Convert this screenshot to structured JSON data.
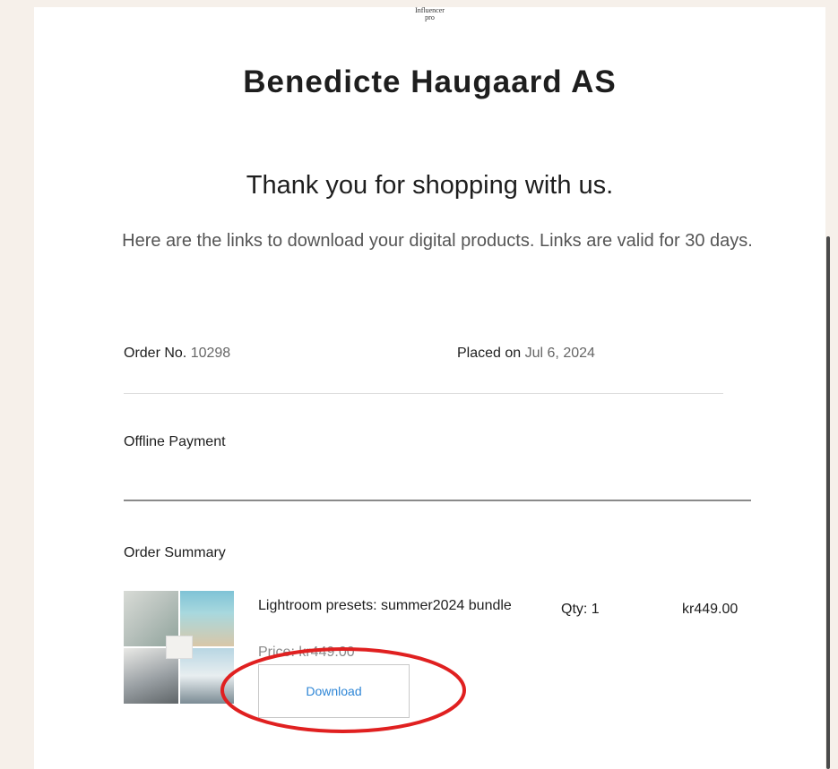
{
  "logo": {
    "line1": "Influencer",
    "line2": "pro"
  },
  "brand": "Benedicte Haugaard AS",
  "thanks": "Thank you for shopping with us.",
  "intro": "Here are the links to download your digital products. Links are valid for 30 days.",
  "order": {
    "number_label": "Order No.",
    "number_value": "10298",
    "placed_label": "Placed on",
    "placed_value": "Jul 6, 2024"
  },
  "payment_method": "Offline Payment",
  "summary": {
    "title": "Order Summary",
    "items": [
      {
        "name": "Lightroom presets: summer2024 bundle",
        "price_line": "Price: kr449.00",
        "qty": "Qty: 1",
        "total": "kr449.00",
        "download_label": "Download",
        "thumb_icon": "product-collage-image"
      }
    ]
  },
  "colors": {
    "page_bg": "#f6f0ea",
    "link": "#2e86d6",
    "annotation": "#e02020"
  }
}
